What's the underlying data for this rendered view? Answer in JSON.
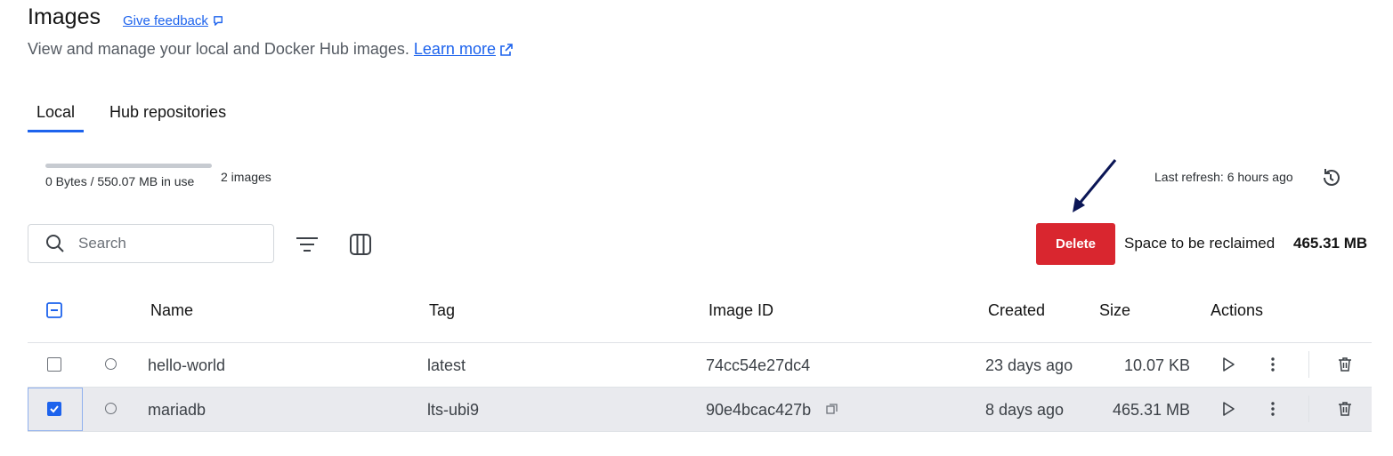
{
  "page": {
    "title": "Images",
    "feedback_label": "Give feedback",
    "subtitle": "View and manage your local and Docker Hub images.",
    "learn_more": "Learn more"
  },
  "tabs": [
    {
      "label": "Local",
      "active": true
    },
    {
      "label": "Hub repositories",
      "active": false
    }
  ],
  "usage": {
    "text": "0 Bytes / 550.07 MB in use",
    "fraction": 0,
    "count": "2 images"
  },
  "refresh": {
    "text": "Last refresh: 6 hours ago"
  },
  "search": {
    "placeholder": "Search",
    "value": ""
  },
  "delete_label": "Delete",
  "reclaim": {
    "label": "Space to be reclaimed",
    "value": "465.31 MB"
  },
  "table": {
    "headers": {
      "name": "Name",
      "tag": "Tag",
      "image_id": "Image ID",
      "created": "Created",
      "size": "Size",
      "actions": "Actions"
    },
    "rows": [
      {
        "name": "hello-world",
        "tag": "latest",
        "image_id": "74cc54e27dc4",
        "created": "23 days ago",
        "size": "10.07 KB",
        "selected": false
      },
      {
        "name": "mariadb",
        "tag": "lts-ubi9",
        "image_id": "90e4bcac427b",
        "created": "8 days ago",
        "size": "465.31 MB",
        "selected": true
      }
    ]
  },
  "colors": {
    "accent": "#1d63ed",
    "danger": "#d9262f",
    "selected_row": "#e9eaee",
    "annotation_arrow": "#0b1656"
  }
}
